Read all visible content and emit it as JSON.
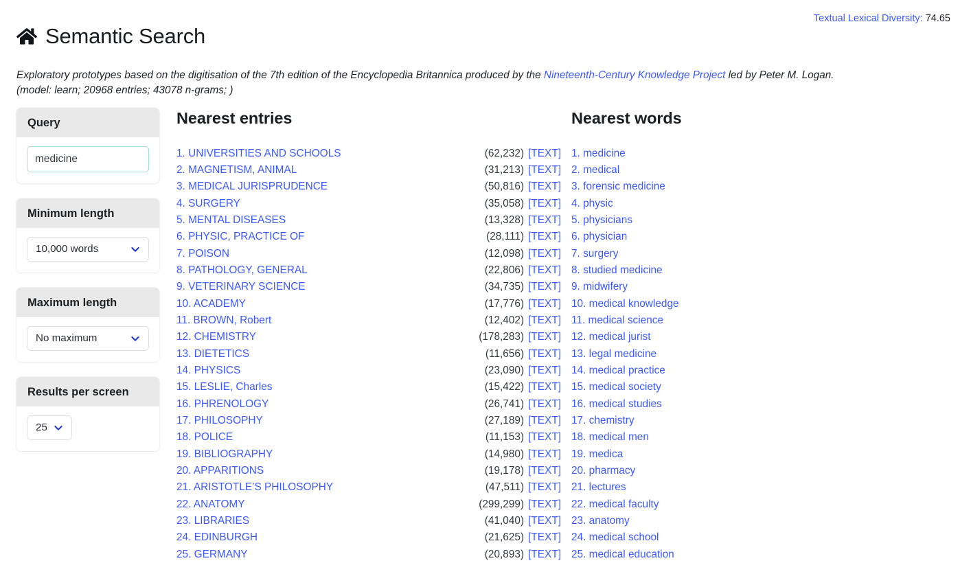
{
  "header": {
    "home_icon": "home-icon",
    "title": "Semantic Search",
    "tld_label": "Textual Lexical Diversity:",
    "tld_value": "74.65",
    "subtitle_part1": "Exploratory prototypes based on the digitisation of the 7th edition of the Encyclopedia Britannica produced by the ",
    "subtitle_link": "Nineteenth-Century Knowledge Project",
    "subtitle_part2": " led by Peter M. Logan.",
    "model_line": "(model: learn; 20968 entries; 43078 n-grams; )"
  },
  "sidebar": {
    "query": {
      "label": "Query",
      "value": "medicine",
      "placeholder": "medicine"
    },
    "minimum_length": {
      "label": "Minimum length",
      "value": "10,000 words"
    },
    "maximum_length": {
      "label": "Maximum length",
      "value": "No maximum"
    },
    "results_per_screen": {
      "label": "Results per screen",
      "value": "25"
    }
  },
  "entries_column": {
    "title": "Nearest entries",
    "text_link_label": "[TEXT]",
    "rows": [
      {
        "rank": "1.",
        "name": "UNIVERSITIES AND SCHOOLS",
        "count": "(62,232)"
      },
      {
        "rank": "2.",
        "name": "MAGNETISM, ANIMAL",
        "count": "(31,213)"
      },
      {
        "rank": "3.",
        "name": "MEDICAL JURISPRUDENCE",
        "count": "(50,816)"
      },
      {
        "rank": "4.",
        "name": "SURGERY",
        "count": "(35,058)"
      },
      {
        "rank": "5.",
        "name": "MENTAL DISEASES",
        "count": "(13,328)"
      },
      {
        "rank": "6.",
        "name": "PHYSIC, PRACTICE OF",
        "count": "(28,111)"
      },
      {
        "rank": "7.",
        "name": "POISON",
        "count": "(12,098)"
      },
      {
        "rank": "8.",
        "name": "PATHOLOGY, GENERAL",
        "count": "(22,806)"
      },
      {
        "rank": "9.",
        "name": "VETERINARY SCIENCE",
        "count": "(34,735)"
      },
      {
        "rank": "10.",
        "name": "ACADEMY",
        "count": "(17,776)"
      },
      {
        "rank": "11.",
        "name": "BROWN, Robert",
        "count": "(12,402)"
      },
      {
        "rank": "12.",
        "name": "CHEMISTRY",
        "count": "(178,283)"
      },
      {
        "rank": "13.",
        "name": "DIETETICS",
        "count": "(11,656)"
      },
      {
        "rank": "14.",
        "name": "PHYSICS",
        "count": "(23,090)"
      },
      {
        "rank": "15.",
        "name": "LESLIE, Charles",
        "count": "(15,422)"
      },
      {
        "rank": "16.",
        "name": "PHRENOLOGY",
        "count": "(26,741)"
      },
      {
        "rank": "17.",
        "name": "PHILOSOPHY",
        "count": "(27,189)"
      },
      {
        "rank": "18.",
        "name": "POLICE",
        "count": "(11,153)"
      },
      {
        "rank": "19.",
        "name": "BIBLIOGRAPHY",
        "count": "(14,980)"
      },
      {
        "rank": "20.",
        "name": "APPARITIONS",
        "count": "(19,178)"
      },
      {
        "rank": "21.",
        "name": "ARISTOTLE’S PHILOSOPHY",
        "count": "(47,511)"
      },
      {
        "rank": "22.",
        "name": "ANATOMY",
        "count": "(299,299)"
      },
      {
        "rank": "23.",
        "name": "LIBRARIES",
        "count": "(41,040)"
      },
      {
        "rank": "24.",
        "name": "EDINBURGH",
        "count": "(21,625)"
      },
      {
        "rank": "25.",
        "name": "GERMANY",
        "count": "(20,893)"
      }
    ]
  },
  "words_column": {
    "title": "Nearest words",
    "rows": [
      {
        "rank": "1.",
        "word": "medicine"
      },
      {
        "rank": "2.",
        "word": "medical"
      },
      {
        "rank": "3.",
        "word": "forensic medicine"
      },
      {
        "rank": "4.",
        "word": "physic"
      },
      {
        "rank": "5.",
        "word": "physicians"
      },
      {
        "rank": "6.",
        "word": "physician"
      },
      {
        "rank": "7.",
        "word": "surgery"
      },
      {
        "rank": "8.",
        "word": "studied medicine"
      },
      {
        "rank": "9.",
        "word": "midwifery"
      },
      {
        "rank": "10.",
        "word": "medical knowledge"
      },
      {
        "rank": "11.",
        "word": "medical science"
      },
      {
        "rank": "12.",
        "word": "medical jurist"
      },
      {
        "rank": "13.",
        "word": "legal medicine"
      },
      {
        "rank": "14.",
        "word": "medical practice"
      },
      {
        "rank": "15.",
        "word": "medical society"
      },
      {
        "rank": "16.",
        "word": "medical studies"
      },
      {
        "rank": "17.",
        "word": "chemistry"
      },
      {
        "rank": "18.",
        "word": "medical men"
      },
      {
        "rank": "19.",
        "word": "medica"
      },
      {
        "rank": "20.",
        "word": "pharmacy"
      },
      {
        "rank": "21.",
        "word": "lectures"
      },
      {
        "rank": "22.",
        "word": "medical faculty"
      },
      {
        "rank": "23.",
        "word": "anatomy"
      },
      {
        "rank": "24.",
        "word": "medical school"
      },
      {
        "rank": "25.",
        "word": "medical education"
      }
    ]
  },
  "colors": {
    "link_blue": "#3d5afe",
    "chevron_blue": "#1b36cf",
    "input_border_teal": "#a7dfcf",
    "card_header_gray": "#e9e9e9",
    "text_dark": "#212529"
  }
}
